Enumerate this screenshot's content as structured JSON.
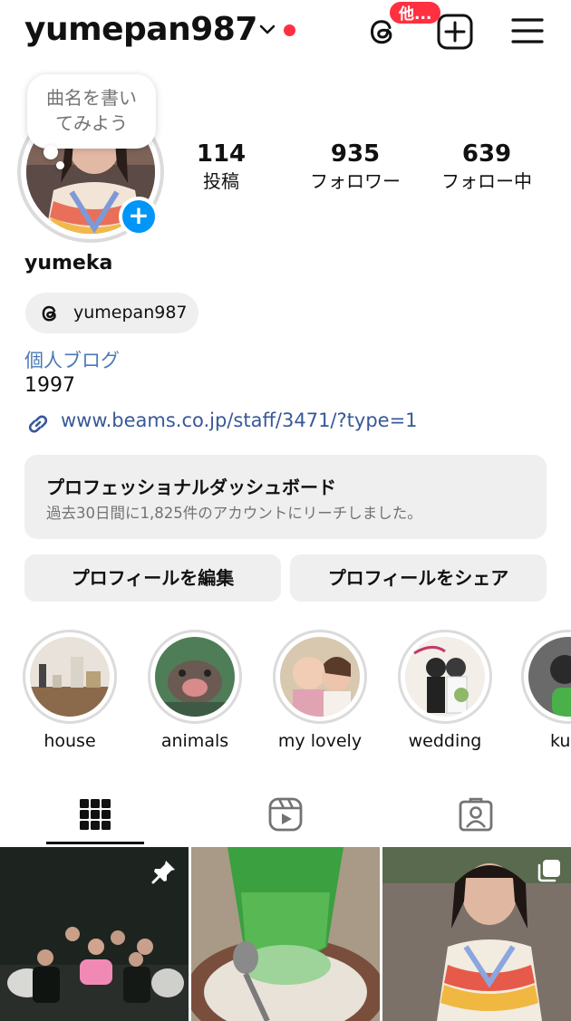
{
  "header": {
    "username": "yumepan987",
    "threads_badge": "他...",
    "colors": {
      "accent": "#0095f6",
      "badge": "#ff3040",
      "link": "#385898"
    }
  },
  "note": {
    "line1": "曲名を書い",
    "line2": "てみよう"
  },
  "stats": [
    {
      "value": "114",
      "label": "投稿"
    },
    {
      "value": "935",
      "label": "フォロワー"
    },
    {
      "value": "639",
      "label": "フォロー中"
    }
  ],
  "profile": {
    "display_name": "yumeka",
    "threads_handle": "yumepan987",
    "category": "個人ブログ",
    "bio": "1997",
    "link": "www.beams.co.jp/staff/3471/?type=1"
  },
  "dashboard": {
    "title": "プロフェッショナルダッシュボード",
    "subtitle": "過去30日間に1,825件のアカウントにリーチしました。"
  },
  "buttons": {
    "edit": "プロフィールを編集",
    "share": "プロフィールをシェア"
  },
  "highlights": [
    {
      "label": "house"
    },
    {
      "label": "animals"
    },
    {
      "label": "my lovely"
    },
    {
      "label": "wedding"
    },
    {
      "label": "ku"
    }
  ],
  "tabs": [
    {
      "icon": "grid-icon",
      "active": true
    },
    {
      "icon": "reels-icon",
      "active": false
    },
    {
      "icon": "tagged-icon",
      "active": false
    }
  ]
}
